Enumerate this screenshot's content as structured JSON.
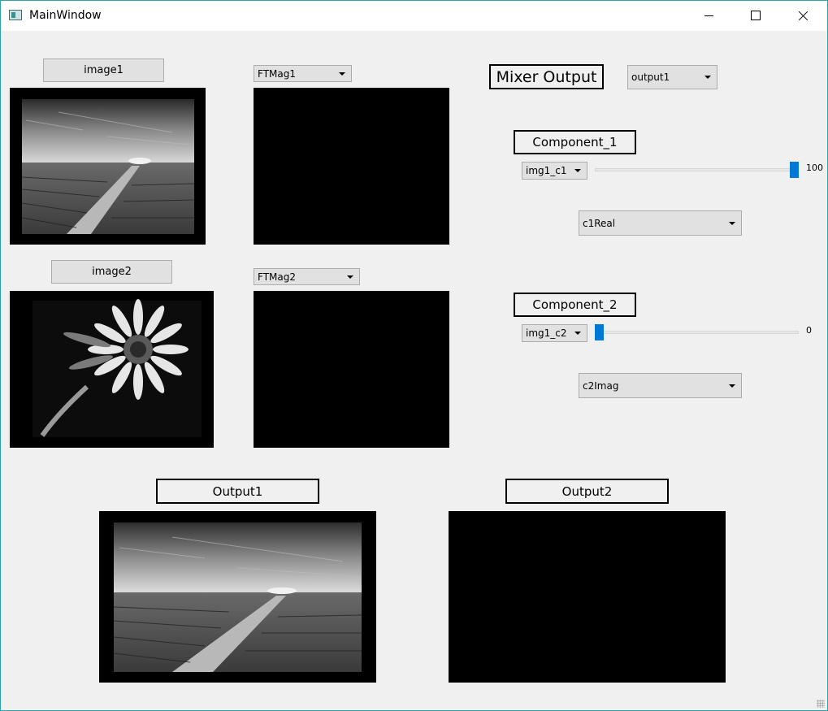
{
  "window": {
    "title": "MainWindow"
  },
  "inputs": {
    "image1": {
      "button_label": "image1",
      "ft_selected": "FTMag1"
    },
    "image2": {
      "button_label": "image2",
      "ft_selected": "FTMag2"
    }
  },
  "mixer": {
    "title": "Mixer Output",
    "output_selected": "output1",
    "component1": {
      "title": "Component_1",
      "source_selected": "img1_c1",
      "slider_value": 100,
      "slider_value_text": "100",
      "type_selected": "c1Real"
    },
    "component2": {
      "title": "Component_2",
      "source_selected": "img1_c2",
      "slider_value": 0,
      "slider_value_text": "0",
      "type_selected": "c2Imag"
    }
  },
  "outputs": {
    "output1": {
      "title": "Output1"
    },
    "output2": {
      "title": "Output2"
    }
  },
  "colors": {
    "accent": "#0078d7",
    "view_background": "#000000",
    "window_background": "#f0f0f0"
  }
}
